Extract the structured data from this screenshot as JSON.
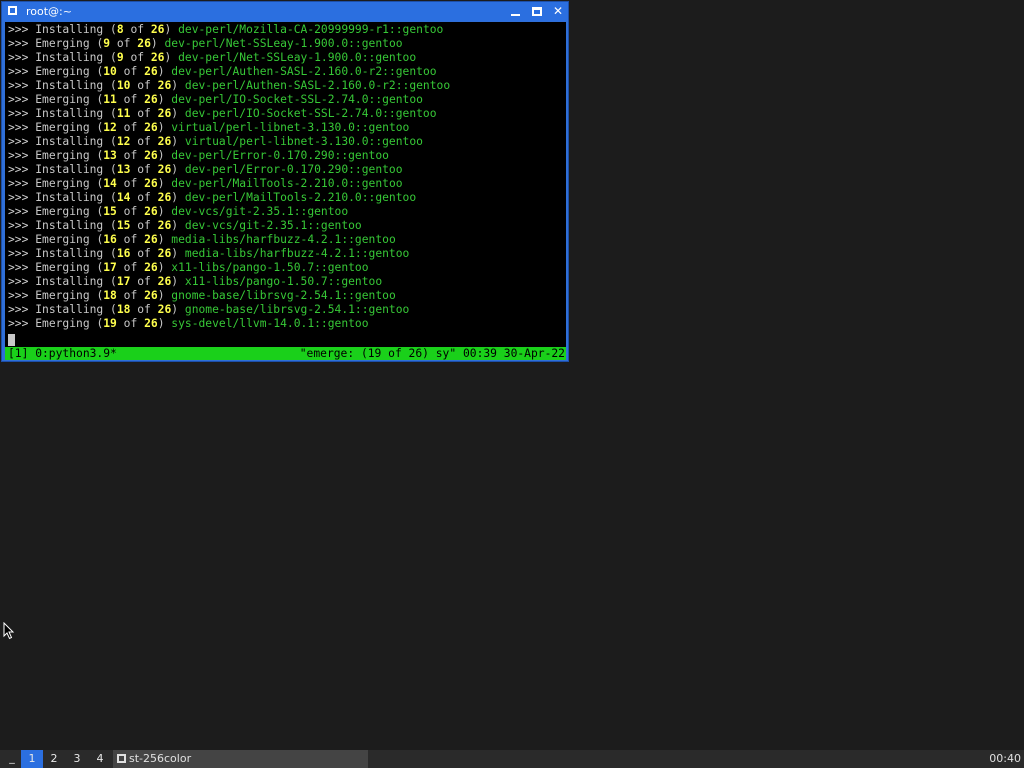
{
  "window": {
    "title": "root@:~"
  },
  "terminal": {
    "lines": [
      {
        "prompt": ">>>",
        "action": "Installing",
        "cur": "8",
        "total": "26",
        "pkg": "dev-perl/Mozilla-CA-20999999-r1::gentoo"
      },
      {
        "prompt": ">>>",
        "action": "Emerging",
        "cur": "9",
        "total": "26",
        "pkg": "dev-perl/Net-SSLeay-1.900.0::gentoo"
      },
      {
        "prompt": ">>>",
        "action": "Installing",
        "cur": "9",
        "total": "26",
        "pkg": "dev-perl/Net-SSLeay-1.900.0::gentoo"
      },
      {
        "prompt": ">>>",
        "action": "Emerging",
        "cur": "10",
        "total": "26",
        "pkg": "dev-perl/Authen-SASL-2.160.0-r2::gentoo"
      },
      {
        "prompt": ">>>",
        "action": "Installing",
        "cur": "10",
        "total": "26",
        "pkg": "dev-perl/Authen-SASL-2.160.0-r2::gentoo"
      },
      {
        "prompt": ">>>",
        "action": "Emerging",
        "cur": "11",
        "total": "26",
        "pkg": "dev-perl/IO-Socket-SSL-2.74.0::gentoo"
      },
      {
        "prompt": ">>>",
        "action": "Installing",
        "cur": "11",
        "total": "26",
        "pkg": "dev-perl/IO-Socket-SSL-2.74.0::gentoo"
      },
      {
        "prompt": ">>>",
        "action": "Emerging",
        "cur": "12",
        "total": "26",
        "pkg": "virtual/perl-libnet-3.130.0::gentoo"
      },
      {
        "prompt": ">>>",
        "action": "Installing",
        "cur": "12",
        "total": "26",
        "pkg": "virtual/perl-libnet-3.130.0::gentoo"
      },
      {
        "prompt": ">>>",
        "action": "Emerging",
        "cur": "13",
        "total": "26",
        "pkg": "dev-perl/Error-0.170.290::gentoo"
      },
      {
        "prompt": ">>>",
        "action": "Installing",
        "cur": "13",
        "total": "26",
        "pkg": "dev-perl/Error-0.170.290::gentoo"
      },
      {
        "prompt": ">>>",
        "action": "Emerging",
        "cur": "14",
        "total": "26",
        "pkg": "dev-perl/MailTools-2.210.0::gentoo"
      },
      {
        "prompt": ">>>",
        "action": "Installing",
        "cur": "14",
        "total": "26",
        "pkg": "dev-perl/MailTools-2.210.0::gentoo"
      },
      {
        "prompt": ">>>",
        "action": "Emerging",
        "cur": "15",
        "total": "26",
        "pkg": "dev-vcs/git-2.35.1::gentoo"
      },
      {
        "prompt": ">>>",
        "action": "Installing",
        "cur": "15",
        "total": "26",
        "pkg": "dev-vcs/git-2.35.1::gentoo"
      },
      {
        "prompt": ">>>",
        "action": "Emerging",
        "cur": "16",
        "total": "26",
        "pkg": "media-libs/harfbuzz-4.2.1::gentoo"
      },
      {
        "prompt": ">>>",
        "action": "Installing",
        "cur": "16",
        "total": "26",
        "pkg": "media-libs/harfbuzz-4.2.1::gentoo"
      },
      {
        "prompt": ">>>",
        "action": "Emerging",
        "cur": "17",
        "total": "26",
        "pkg": "x11-libs/pango-1.50.7::gentoo"
      },
      {
        "prompt": ">>>",
        "action": "Installing",
        "cur": "17",
        "total": "26",
        "pkg": "x11-libs/pango-1.50.7::gentoo"
      },
      {
        "prompt": ">>>",
        "action": "Emerging",
        "cur": "18",
        "total": "26",
        "pkg": "gnome-base/librsvg-2.54.1::gentoo"
      },
      {
        "prompt": ">>>",
        "action": "Installing",
        "cur": "18",
        "total": "26",
        "pkg": "gnome-base/librsvg-2.54.1::gentoo"
      },
      {
        "prompt": ">>>",
        "action": "Emerging",
        "cur": "19",
        "total": "26",
        "pkg": "sys-devel/llvm-14.0.1::gentoo"
      }
    ],
    "status_left": "[1] 0:python3.9*",
    "status_right": "\"emerge: (19 of 26) sy\" 00:39 30-Apr-22"
  },
  "taskbar": {
    "menu_label": "_",
    "workspaces": [
      "1",
      "2",
      "3",
      "4"
    ],
    "task_label": "st-256color",
    "clock": "00:40"
  },
  "colors": {
    "title_bar": "#2b6fe0",
    "status_bar": "#1ad01a",
    "package_text": "#37c837",
    "number_text": "#ffff4d"
  }
}
